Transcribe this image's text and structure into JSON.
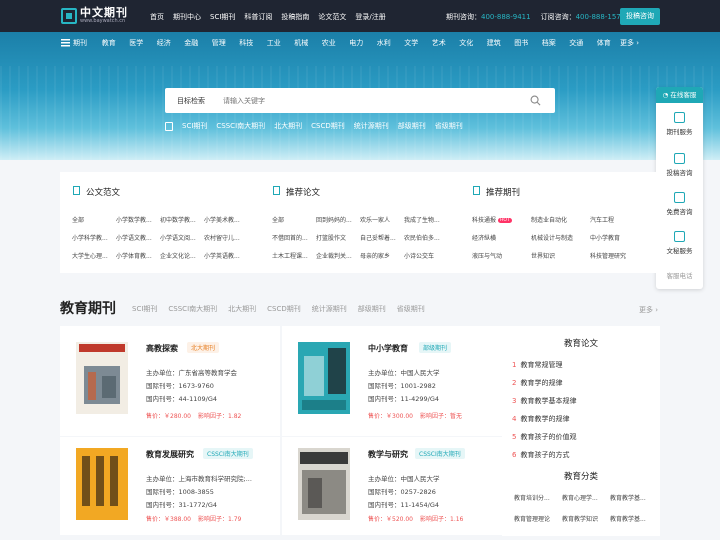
{
  "header": {
    "logo_cn": "中文期刊",
    "logo_url": "www.baywatch.cn",
    "nav": [
      "首页",
      "期刊中心",
      "SCI期刊",
      "科普订阅",
      "投稿指南",
      "论文范文",
      "登录/注册"
    ],
    "hotline_label": "期刊咨询：",
    "hotline": "400-888-9411",
    "order_label": "订阅咨询：",
    "order": "400-888-1571",
    "submit": "投稿咨询"
  },
  "subnav": {
    "first": "期刊",
    "items": [
      "教育",
      "医学",
      "经济",
      "金融",
      "管理",
      "科技",
      "工业",
      "机械",
      "农业",
      "电力",
      "水利",
      "文学",
      "艺术",
      "文化",
      "建筑",
      "图书",
      "档案",
      "交通",
      "体育"
    ],
    "more": "更多"
  },
  "search": {
    "label": "目标检索",
    "placeholder": "请输入关键字"
  },
  "tags": [
    "SCI期刊",
    "CSSCI南大期刊",
    "北大期刊",
    "CSCD期刊",
    "统计源期刊",
    "部级期刊",
    "省级期刊"
  ],
  "float": {
    "title": "在线客服",
    "items": [
      "期刊服务",
      "投稿咨询",
      "免费咨询",
      "文秘服务"
    ],
    "tel": "客服电话"
  },
  "panels": [
    {
      "title": "公文范文",
      "cells": [
        "全部",
        "小学数学教...",
        "初中数学教...",
        "小学美术教...",
        "小学科学教...",
        "小学语文教...",
        "小学语文阅...",
        "农村留守儿...",
        "大学生心理...",
        "小学体育教...",
        "企业文化论...",
        "小学英语教..."
      ]
    },
    {
      "title": "推荐论文",
      "cells": [
        "全部",
        "回到妈妈的...",
        "欢乐一家人",
        "我成了生物...",
        "不借回首的...",
        "打篮股作文",
        "自己妥帮着...",
        "农民伯伯多...",
        "土木工程课...",
        "企业裁判关...",
        "母亲的家乡",
        "小诗公交车"
      ]
    },
    {
      "title": "推荐期刊",
      "hot": "HOT",
      "cells": [
        "科技通报",
        "制造业自动化",
        "汽车工程",
        "经济纵横",
        "机械设计与制造",
        "中小学教育",
        "液压与气动",
        "世界知识",
        "科技管理研究"
      ]
    }
  ],
  "section": {
    "title": "教育期刊",
    "tabs": [
      "SCI期刊",
      "CSSCI南大期刊",
      "北大期刊",
      "CSCD期刊",
      "统计源期刊",
      "部级期刊",
      "省级期刊"
    ],
    "more": "更多"
  },
  "journals": [
    {
      "name": "高教探索",
      "badge": "北大期刊",
      "badge_color": "#e9c3a6",
      "org": "主办单位：广东省高等教育学会",
      "intl": "国际刊号：1673-9760",
      "dom": "国内刊号：44-1109/G4",
      "price": "售价：￥280.00",
      "if": "影响因子：1.82"
    },
    {
      "name": "中小学教育",
      "badge": "部级期刊",
      "badge_color": "#a9dde3",
      "org": "主办单位：中国人民大学",
      "intl": "国际刊号：1001-2982",
      "dom": "国内刊号：11-4299/G4",
      "price": "售价：￥300.00",
      "if": "影响因子：暂无"
    },
    {
      "name": "教育发展研究",
      "badge": "CSSCI南大期刊",
      "badge_color": "#a9dde3",
      "org": "主办单位：上海市教育科学研究院;...",
      "intl": "国际刊号：1008-3855",
      "dom": "国内刊号：31-1772/G4",
      "price": "售价：￥388.00",
      "if": "影响因子：1.79"
    },
    {
      "name": "教学与研究",
      "badge": "CSSCI南大期刊",
      "badge_color": "#a9dde3",
      "org": "主办单位：中国人民大学",
      "intl": "国际刊号：0257-2826",
      "dom": "国内刊号：11-1454/G4",
      "price": "售价：￥520.00",
      "if": "影响因子：1.16"
    }
  ],
  "right": {
    "papers_title": "教育论文",
    "papers": [
      "教育常规管理",
      "教育学的规律",
      "教育教学基本规律",
      "教育教学的规律",
      "教育孩子的价值观",
      "教育孩子的方式"
    ],
    "cat_title": "教育分类",
    "cats": [
      "教育培训分...",
      "教育心理学...",
      "教育教学基...",
      "教育管理理论",
      "教育教学知识",
      "教育教学基..."
    ]
  }
}
